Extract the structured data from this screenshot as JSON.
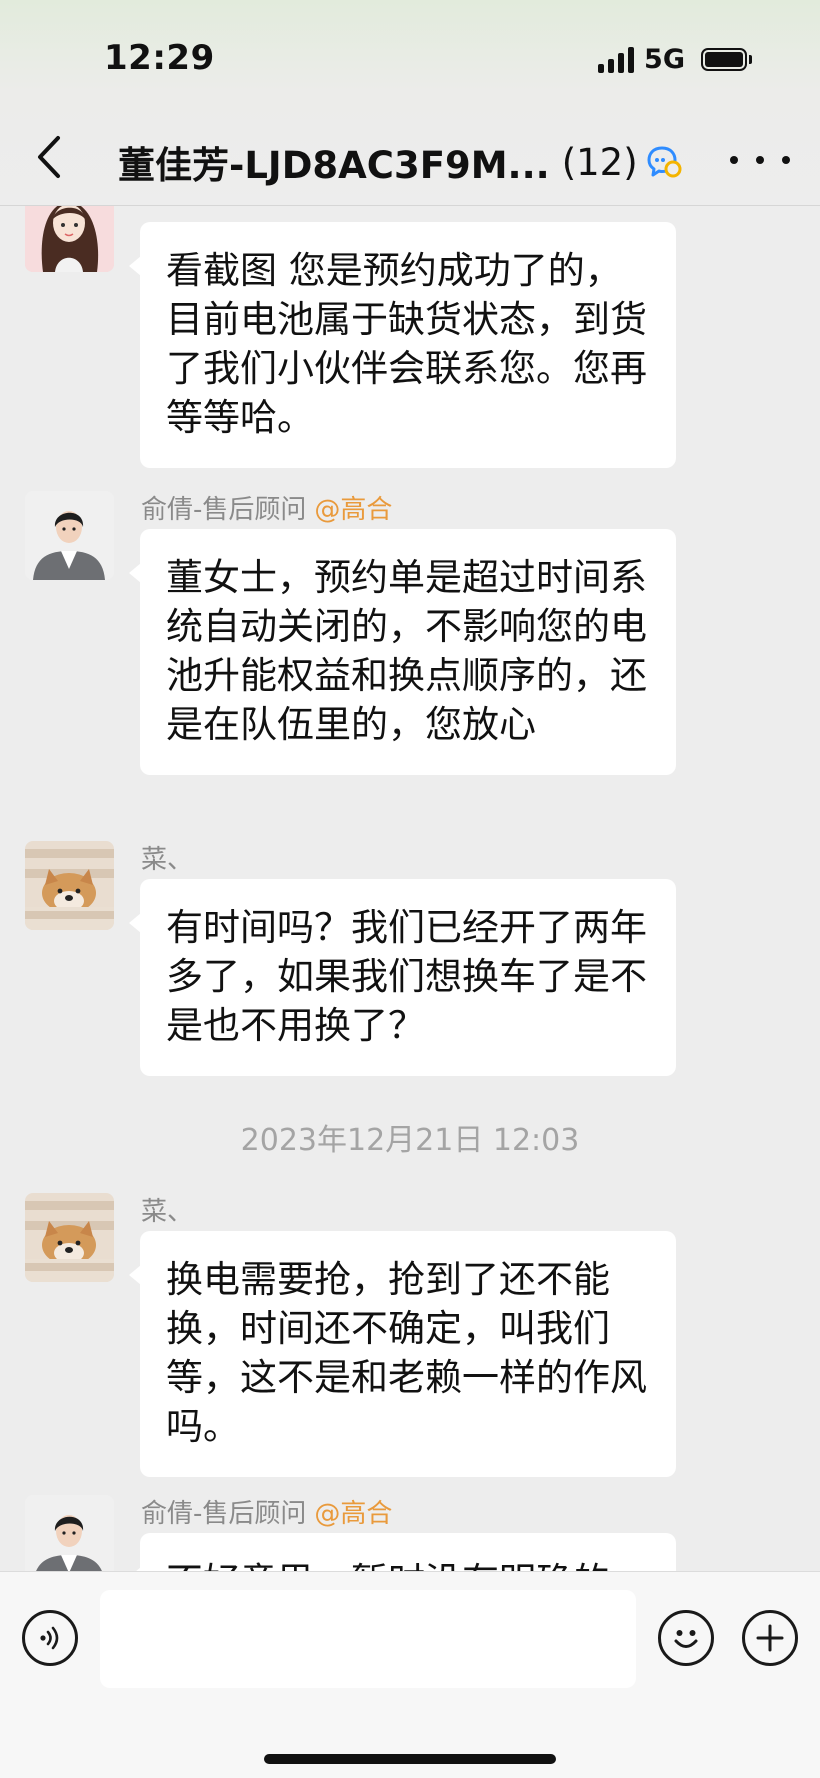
{
  "status_bar": {
    "time": "12:29",
    "network": "5G"
  },
  "header": {
    "title": "董佳芳-LJD8AC3F9M...",
    "member_count": "(12)"
  },
  "messages": [
    {
      "type": "text",
      "sender": "",
      "mention": "",
      "avatar": "woman-illustration",
      "text": "看截图 您是预约成功了的，目前电池属于缺货状态，到货了我们小伙伴会联系您。您再等等哈。"
    },
    {
      "type": "text",
      "sender": "俞倩-售后顾问",
      "mention": "@高合",
      "avatar": "woman-in-suit",
      "text": "董女士，预约单是超过时间系统自动关闭的，不影响您的电池升能权益和换点顺序的，还是在队伍里的，您放心"
    },
    {
      "type": "text",
      "sender": "菜、",
      "mention": "",
      "avatar": "shiba-dog",
      "text": "有时间吗？我们已经开了两年多了，如果我们想换车了是不是也不用换了？"
    },
    {
      "type": "timestamp",
      "text": "2023年12月21日 12:03"
    },
    {
      "type": "text",
      "sender": "菜、",
      "mention": "",
      "avatar": "shiba-dog",
      "text": "换电需要抢，抢到了还不能换，时间还不确定，叫我们等，这不是和老赖一样的作风吗。"
    },
    {
      "type": "text",
      "sender": "俞倩-售后顾问",
      "mention": "@高合",
      "avatar": "woman-in-suit",
      "text": "不好意思，暂时没有明确的"
    }
  ],
  "input_bar": {
    "placeholder": "",
    "value": ""
  },
  "icons": {
    "back": "chevron-left-icon",
    "group": "group-chat-icon",
    "more": "more-dots-icon",
    "voice": "voice-icon",
    "emoji": "smiley-icon",
    "add": "plus-icon"
  },
  "colors": {
    "mention": "#e99a3c",
    "chat_background": "#ededed",
    "bubble": "#ffffff",
    "group_icon": "#2f8cff"
  }
}
